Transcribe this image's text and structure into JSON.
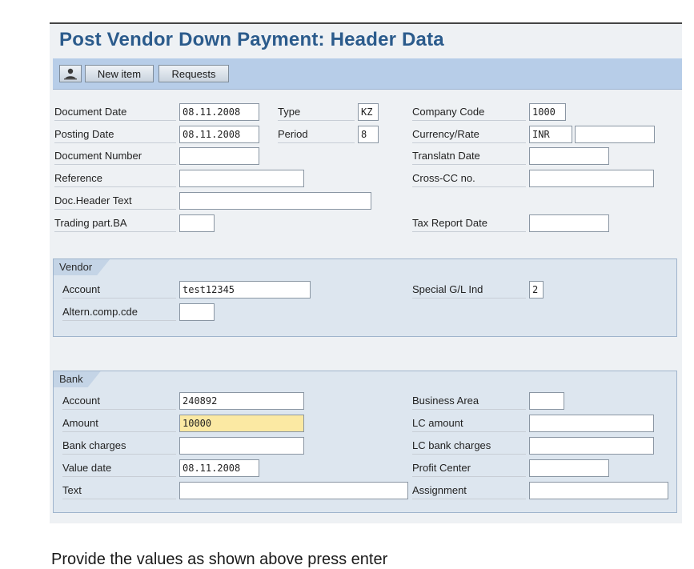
{
  "title": "Post Vendor Down Payment: Header Data",
  "toolbar": {
    "icon": "person-icon",
    "new_item": "New item",
    "requests": "Requests"
  },
  "header": {
    "document_date": {
      "label": "Document Date",
      "value": "08.11.2008"
    },
    "type": {
      "label": "Type",
      "value": "KZ"
    },
    "company_code": {
      "label": "Company Code",
      "value": "1000"
    },
    "posting_date": {
      "label": "Posting Date",
      "value": "08.11.2008"
    },
    "period": {
      "label": "Period",
      "value": "8"
    },
    "currency_rate": {
      "label": "Currency/Rate",
      "value": "INR",
      "rate": ""
    },
    "document_number": {
      "label": "Document Number",
      "value": ""
    },
    "translation_date": {
      "label": "Translatn Date",
      "value": ""
    },
    "reference": {
      "label": "Reference",
      "value": ""
    },
    "cross_cc": {
      "label": "Cross-CC no.",
      "value": ""
    },
    "doc_header_text": {
      "label": "Doc.Header Text",
      "value": ""
    },
    "trading_part": {
      "label": "Trading part.BA",
      "value": ""
    },
    "tax_report_date": {
      "label": "Tax Report Date",
      "value": ""
    }
  },
  "vendor": {
    "title": "Vendor",
    "account": {
      "label": "Account",
      "value": "test12345"
    },
    "special_gl": {
      "label": "Special G/L Ind",
      "value": "2"
    },
    "altern_comp": {
      "label": "Altern.comp.cde",
      "value": ""
    }
  },
  "bank": {
    "title": "Bank",
    "account": {
      "label": "Account",
      "value": "240892"
    },
    "business_area": {
      "label": "Business Area",
      "value": ""
    },
    "amount": {
      "label": "Amount",
      "value": "10000"
    },
    "lc_amount": {
      "label": "LC amount",
      "value": ""
    },
    "bank_charges": {
      "label": "Bank charges",
      "value": ""
    },
    "lc_bank_charges": {
      "label": "LC bank charges",
      "value": ""
    },
    "value_date": {
      "label": "Value date",
      "value": "08.11.2008"
    },
    "profit_center": {
      "label": "Profit Center",
      "value": ""
    },
    "text": {
      "label": "Text",
      "value": ""
    },
    "assignment": {
      "label": "Assignment",
      "value": ""
    }
  },
  "instruction": "Provide the values as shown above press enter",
  "colors": {
    "title": "#2b5b8c",
    "toolbar": "#b7cde8",
    "highlight": "#fbe9a3"
  }
}
